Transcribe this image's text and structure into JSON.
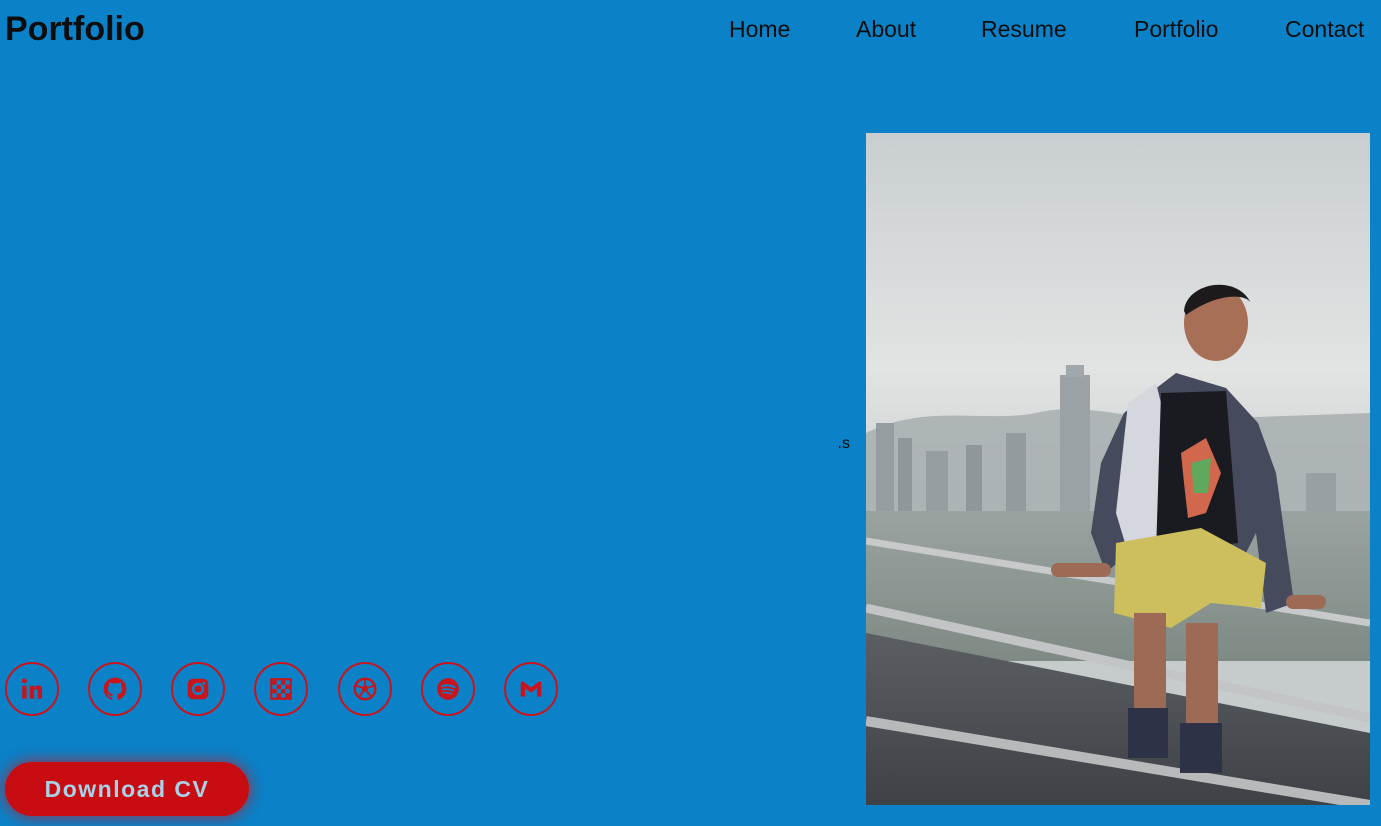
{
  "header": {
    "logo": "Portfolio",
    "nav": [
      "Home",
      "About",
      "Resume",
      "Portfolio",
      "Contact"
    ]
  },
  "hero": {
    "stray_text": "s."
  },
  "social_icons": [
    "linkedin-icon",
    "github-icon",
    "instagram-icon",
    "chess-icon",
    "soccer-ball-icon",
    "spotify-icon",
    "gmail-icon"
  ],
  "cta": {
    "download_cv": "Download CV"
  },
  "colors": {
    "background": "#0b81c7",
    "accent_red": "#c8141c",
    "button_text": "#a8d2e8",
    "text": "#0d0d0d"
  }
}
